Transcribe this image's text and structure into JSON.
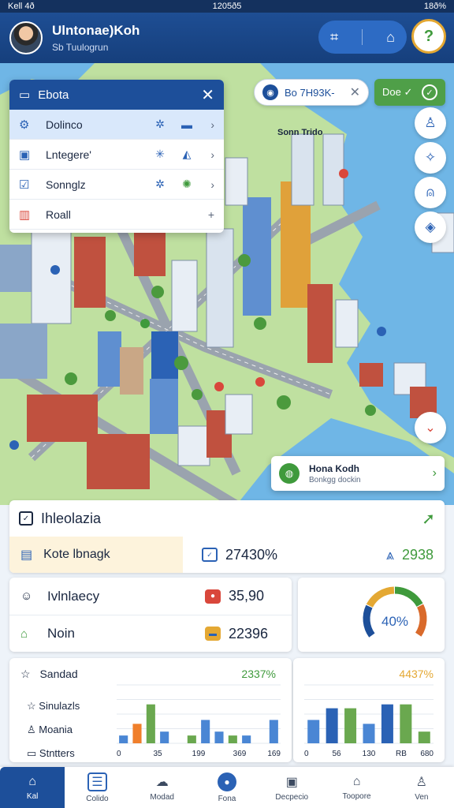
{
  "status_bar": {
    "left": "Kell 4ð",
    "center": "1205ð5",
    "right": "18ð%"
  },
  "header": {
    "title": "Ulntonae)Koh",
    "subtitle": "Sb Tuulogrun"
  },
  "layer_menu": {
    "title": "Ebota",
    "items": [
      {
        "label": "Dolinco",
        "icon": "gear-icon"
      },
      {
        "label": "Lntegere'",
        "icon": "doc-icon"
      },
      {
        "label": "Sonnglz",
        "icon": "edit-icon"
      },
      {
        "label": "Roall",
        "icon": "pin-icon"
      }
    ]
  },
  "map": {
    "search_label": "Bo 7H93K-",
    "chip_label": "Doe ✓",
    "place_label": "Sonn Trido",
    "poi": {
      "name": "Hona Kodh",
      "subtitle": "Bonkgg dockin"
    }
  },
  "info_panel": {
    "title": "Ihleolazia",
    "row_label": "Kote lbnagk",
    "row_value": "27430%",
    "row_right": "2938"
  },
  "stats": [
    {
      "label": "Ivlnlaecy",
      "value": "35,90",
      "icon": "smile-icon",
      "value_color": "#d9473b"
    },
    {
      "label": "Noin",
      "value": "22396",
      "icon": "home-icon",
      "value_color": "#e4a833"
    }
  ],
  "gauge": {
    "value": 40,
    "label": "40%",
    "colors": [
      "#1d4f9a",
      "#e4a833",
      "#3f9a3c",
      "#d96a2b"
    ]
  },
  "chart_card_1": {
    "header": "Sandad",
    "headline": "2337%",
    "legend": [
      "Sinulazls",
      "Moania",
      "Stntters"
    ]
  },
  "chart_card_2": {
    "headline": "4437%"
  },
  "chart_data": [
    {
      "type": "bar",
      "x_ticks": [
        "0",
        "35",
        "199",
        "369",
        "169"
      ],
      "series": [
        {
          "color": "#4a86d4",
          "values": [
            4,
            2,
            0,
            6,
            0,
            0,
            12,
            6,
            0,
            4,
            0,
            12
          ]
        },
        {
          "color": "#f07f2b",
          "values": [
            0,
            10,
            0,
            0,
            0,
            0,
            0,
            0,
            0,
            0,
            0,
            0
          ]
        },
        {
          "color": "#6aa84f",
          "values": [
            0,
            0,
            20,
            0,
            0,
            4,
            0,
            0,
            4,
            0,
            0,
            0
          ]
        }
      ],
      "ylim": [
        0,
        30
      ]
    },
    {
      "type": "bar",
      "x_ticks": [
        "0",
        "56",
        "130",
        "RB",
        "680"
      ],
      "series": [
        {
          "color": "#4a86d4",
          "values": [
            12,
            0,
            0,
            10,
            0,
            0,
            0
          ]
        },
        {
          "color": "#2b62b5",
          "values": [
            0,
            18,
            0,
            0,
            20,
            0,
            0
          ]
        },
        {
          "color": "#6aa84f",
          "values": [
            0,
            0,
            18,
            0,
            0,
            20,
            6
          ]
        }
      ],
      "ylim": [
        0,
        30
      ]
    }
  ],
  "bottom_nav": [
    {
      "label": "Kal",
      "icon": "map-icon"
    },
    {
      "label": "Colido",
      "icon": "list-icon"
    },
    {
      "label": "Modad",
      "icon": "cloud-icon"
    },
    {
      "label": "Fona",
      "icon": "circle-icon"
    },
    {
      "label": "Decpecio",
      "icon": "camera-icon"
    },
    {
      "label": "Toopore",
      "icon": "bookmark-icon"
    },
    {
      "label": "Ven",
      "icon": "user-icon"
    }
  ]
}
